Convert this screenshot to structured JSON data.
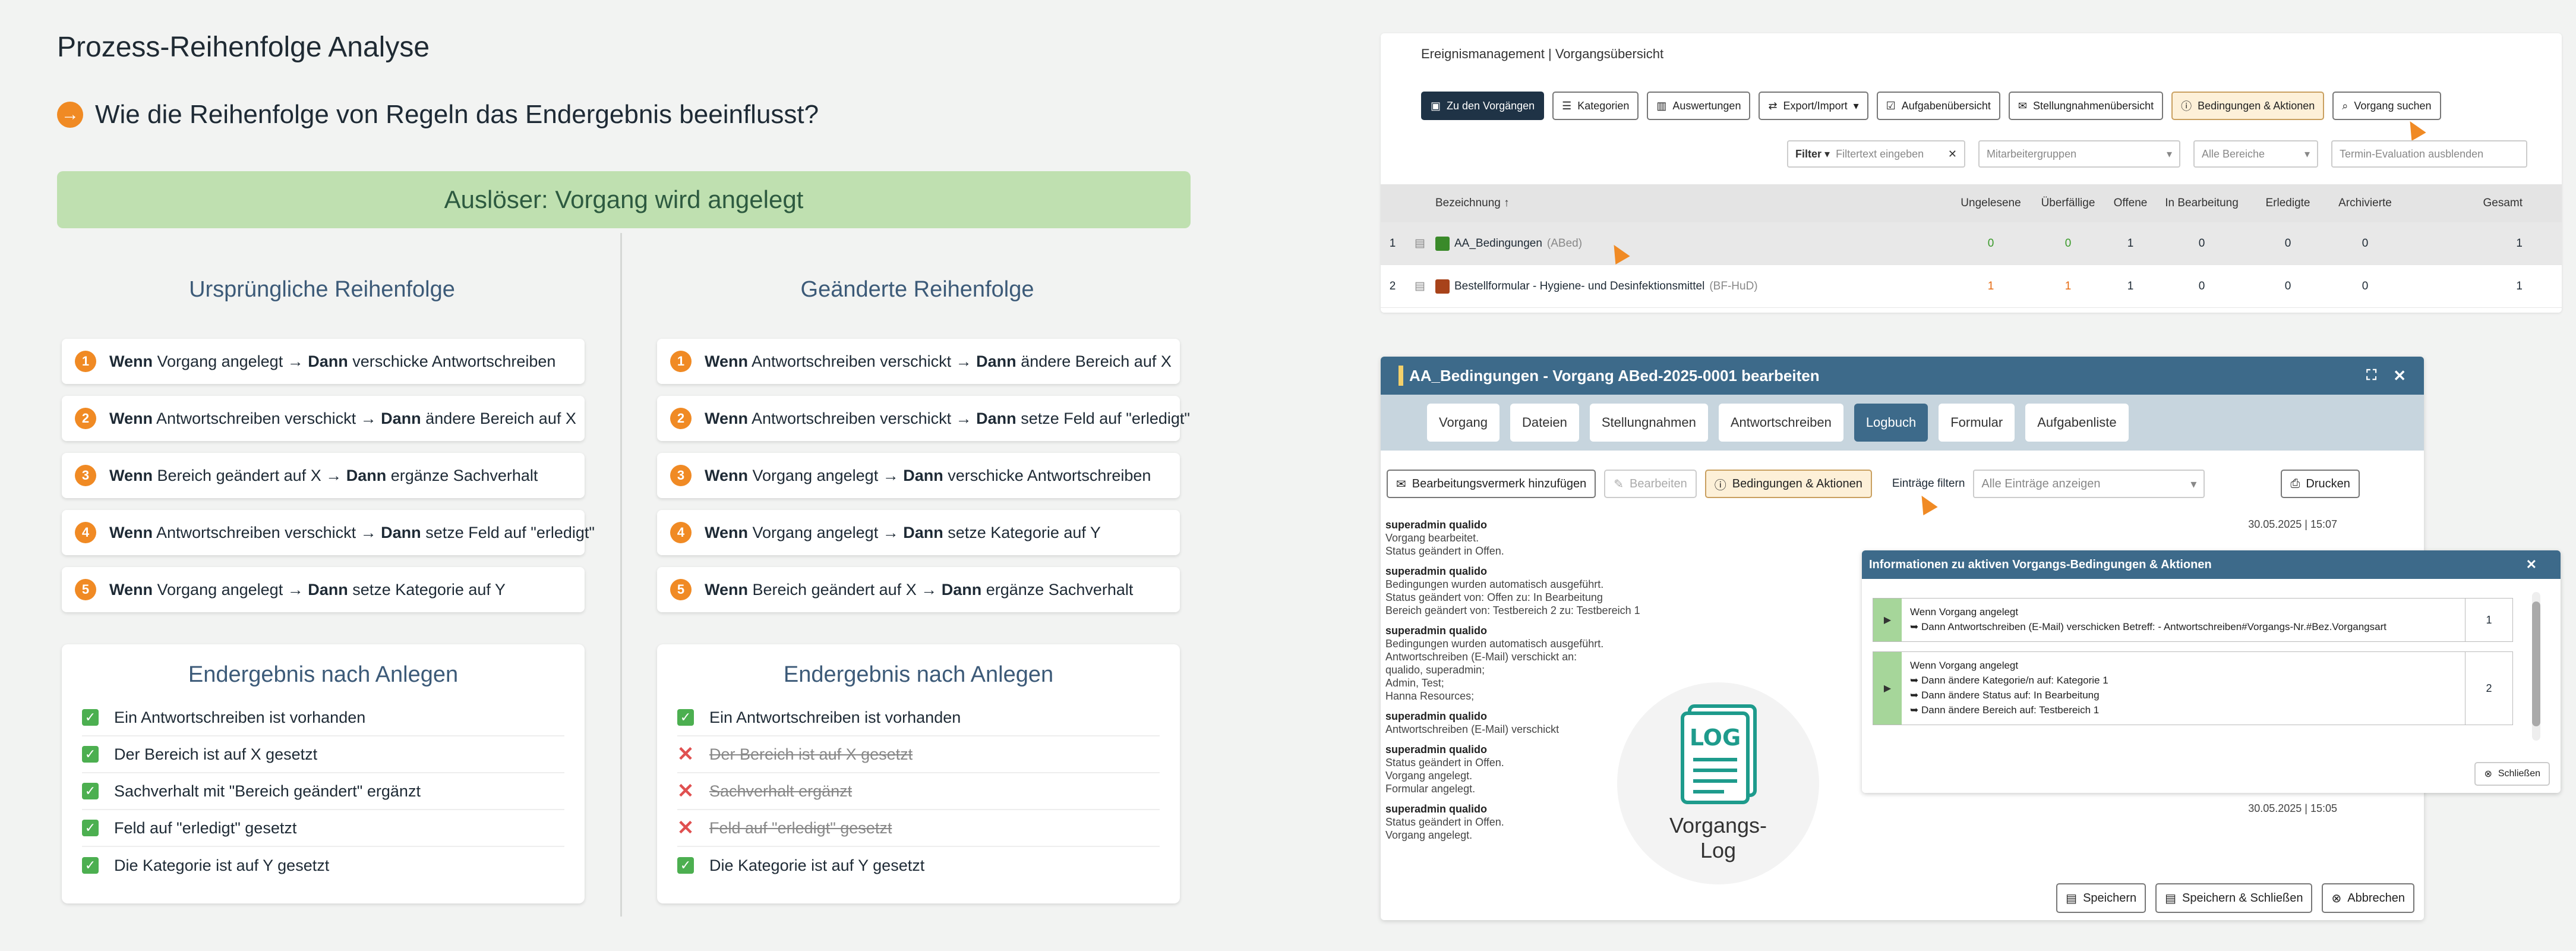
{
  "page": {
    "title": "Prozess-Reihenfolge Analyse",
    "subtitle": "Wie die Reihenfolge von Regeln das Endergebnis beeinflusst?",
    "subtitle_icon": "→",
    "trigger": "Auslöser: Vorgang wird angelegt"
  },
  "left": {
    "title": "Ursprüngliche Reihenfolge",
    "rules": [
      {
        "n": "1",
        "w": "Wenn",
        "a": "Vorgang angelegt →",
        "d": "Dann",
        "b": "verschicke Antwortschreiben"
      },
      {
        "n": "2",
        "w": "Wenn",
        "a": "Antwortschreiben verschickt →",
        "d": "Dann",
        "b": "ändere Bereich auf X"
      },
      {
        "n": "3",
        "w": "Wenn",
        "a": "Bereich geändert auf X →",
        "d": "Dann",
        "b": "ergänze Sachverhalt"
      },
      {
        "n": "4",
        "w": "Wenn",
        "a": "Antwortschreiben verschickt →",
        "d": "Dann",
        "b": "setze Feld auf \"erledigt\""
      },
      {
        "n": "5",
        "w": "Wenn",
        "a": "Vorgang angelegt →",
        "d": "Dann",
        "b": "setze Kategorie auf Y"
      }
    ],
    "result_title": "Endergebnis nach Anlegen",
    "results": [
      "Ein Antwortschreiben ist vorhanden",
      "Der Bereich ist auf X gesetzt",
      "Sachverhalt mit \"Bereich geändert\" ergänzt",
      "Feld auf \"erledigt\" gesetzt",
      "Die Kategorie ist auf Y gesetzt"
    ]
  },
  "right": {
    "title": "Geänderte Reihenfolge",
    "rules": [
      {
        "n": "1",
        "w": "Wenn",
        "a": "Antwortschreiben verschickt →",
        "d": "Dann",
        "b": "ändere Bereich auf X"
      },
      {
        "n": "2",
        "w": "Wenn",
        "a": "Antwortschreiben verschickt →",
        "d": "Dann",
        "b": "setze Feld auf \"erledigt\""
      },
      {
        "n": "3",
        "w": "Wenn",
        "a": "Vorgang angelegt →",
        "d": "Dann",
        "b": "verschicke Antwortschreiben"
      },
      {
        "n": "4",
        "w": "Wenn",
        "a": "Vorgang angelegt →",
        "d": "Dann",
        "b": "setze Kategorie auf Y"
      },
      {
        "n": "5",
        "w": "Wenn",
        "a": "Bereich geändert auf X →",
        "d": "Dann",
        "b": "ergänze Sachverhalt"
      }
    ],
    "result_title": "Endergebnis nach Anlegen",
    "results": [
      "Ein Antwortschreiben ist vorhanden",
      "Der Bereich ist auf X gesetzt",
      "Sachverhalt ergänzt",
      "Feld auf \"erledigt\" gesetzt",
      "Die Kategorie ist auf Y gesetzt"
    ]
  },
  "overview": {
    "header": "Ereignismanagement | Vorgangsübersicht",
    "buttons": [
      "Zu den Vorgängen",
      "Kategorien",
      "Auswertungen",
      "Export/Import",
      "Aufgabenübersicht",
      "Stellungnahmenübersicht",
      "Bedingungen & Aktionen",
      "Vorgang suchen"
    ],
    "filter_label": "Filter",
    "filter_placeholder": "Filtertext eingeben",
    "group_placeholder": "Mitarbeitergruppen",
    "area_placeholder": "Alle Bereiche",
    "eval_placeholder": "Termin-Evaluation ausblenden",
    "columns": [
      "Bezeichnung ↑",
      "Ungelesene",
      "Überfällige",
      "Offene",
      "In Bearbeitung",
      "Erledigte",
      "Archivierte",
      "Gesamt"
    ],
    "rows": [
      {
        "idx": "1",
        "name": "AA_Bedingungen",
        "abbr": "(ABed)",
        "color": "#3a8a2a",
        "vals": [
          "0",
          "0",
          "1",
          "0",
          "0",
          "0",
          "1"
        ]
      },
      {
        "idx": "2",
        "name": "Bestellformular - Hygiene- und Desinfektionsmittel",
        "abbr": "(BF-HuD)",
        "color": "#a8431a",
        "vals": [
          "1",
          "1",
          "1",
          "0",
          "0",
          "0",
          "1"
        ]
      }
    ]
  },
  "modal": {
    "title": "AA_Bedingungen - Vorgang ABed-2025-0001 bearbeiten",
    "tabs": [
      "Vorgang",
      "Dateien",
      "Stellungnahmen",
      "Antwortschreiben",
      "Logbuch",
      "Formular",
      "Aufgabenliste"
    ],
    "add_note": "Bearbeitungsvermerk hinzufügen",
    "edit": "Bearbeiten",
    "conditions": "Bedingungen & Aktionen",
    "filter_label": "Einträge filtern",
    "filter_value": "Alle Einträge anzeigen",
    "print": "Drucken",
    "log": [
      {
        "user": "superadmin qualido",
        "lines": [
          "Vorgang bearbeitet.",
          "Status geändert in Offen."
        ],
        "date": "30.05.2025 | 15:07"
      },
      {
        "user": "superadmin qualido",
        "lines": [
          "Bedingungen wurden automatisch ausgeführt.",
          "Status geändert von: Offen zu: In Bearbeitung",
          "Bereich geändert von: Testbereich 2 zu: Testbereich 1"
        ],
        "date": ""
      },
      {
        "user": "superadmin qualido",
        "lines": [
          "Bedingungen wurden automatisch ausgeführt.",
          "Antwortschreiben (E-Mail) verschickt an:",
          "qualido, superadmin;",
          "Admin, Test;",
          "Hanna Resources;"
        ],
        "date": ""
      },
      {
        "user": "superadmin qualido",
        "lines": [
          "Antwortschreiben (E-Mail) verschickt"
        ],
        "date": ""
      },
      {
        "user": "superadmin qualido",
        "lines": [
          "Status geändert in Offen.",
          "Vorgang angelegt.",
          "Formular angelegt."
        ],
        "date": ""
      },
      {
        "user": "superadmin qualido",
        "lines": [
          "Status geändert in Offen.",
          "Vorgang angelegt."
        ],
        "date": "30.05.2025 | 15:05"
      }
    ],
    "log_icon_text": "LOG",
    "log_label": "Vorgangs-\nLog",
    "footer": [
      "Speichern",
      "Speichern & Schließen",
      "Abbrechen"
    ]
  },
  "info": {
    "title": "Informationen zu aktiven Vorgangs-Bedingungen & Aktionen",
    "rows": [
      {
        "lines": [
          "Wenn Vorgang angelegt",
          "➥ Dann Antwortschreiben (E-Mail) verschicken Betreff: - Antwortschreiben#Vorgangs-Nr.#Bez.Vorgangsart"
        ],
        "num": "1"
      },
      {
        "lines": [
          "Wenn Vorgang angelegt",
          "➥ Dann ändere Kategorie/n auf: Kategorie 1",
          "➥ Dann ändere Status auf: In Bearbeitung",
          "➥ Dann ändere Bereich auf: Testbereich 1"
        ],
        "num": "2"
      }
    ],
    "close": "Schließen"
  }
}
